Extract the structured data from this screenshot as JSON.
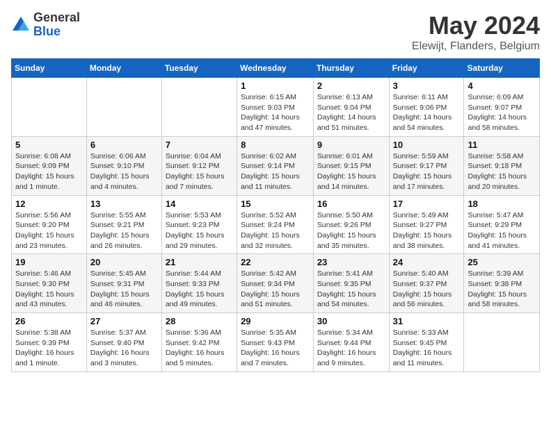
{
  "logo": {
    "general": "General",
    "blue": "Blue"
  },
  "header": {
    "month_year": "May 2024",
    "location": "Elewijt, Flanders, Belgium"
  },
  "weekdays": [
    "Sunday",
    "Monday",
    "Tuesday",
    "Wednesday",
    "Thursday",
    "Friday",
    "Saturday"
  ],
  "weeks": [
    [
      {
        "day": "",
        "info": ""
      },
      {
        "day": "",
        "info": ""
      },
      {
        "day": "",
        "info": ""
      },
      {
        "day": "1",
        "info": "Sunrise: 6:15 AM\nSunset: 9:03 PM\nDaylight: 14 hours and 47 minutes."
      },
      {
        "day": "2",
        "info": "Sunrise: 6:13 AM\nSunset: 9:04 PM\nDaylight: 14 hours and 51 minutes."
      },
      {
        "day": "3",
        "info": "Sunrise: 6:11 AM\nSunset: 9:06 PM\nDaylight: 14 hours and 54 minutes."
      },
      {
        "day": "4",
        "info": "Sunrise: 6:09 AM\nSunset: 9:07 PM\nDaylight: 14 hours and 58 minutes."
      }
    ],
    [
      {
        "day": "5",
        "info": "Sunrise: 6:08 AM\nSunset: 9:09 PM\nDaylight: 15 hours and 1 minute."
      },
      {
        "day": "6",
        "info": "Sunrise: 6:06 AM\nSunset: 9:10 PM\nDaylight: 15 hours and 4 minutes."
      },
      {
        "day": "7",
        "info": "Sunrise: 6:04 AM\nSunset: 9:12 PM\nDaylight: 15 hours and 7 minutes."
      },
      {
        "day": "8",
        "info": "Sunrise: 6:02 AM\nSunset: 9:14 PM\nDaylight: 15 hours and 11 minutes."
      },
      {
        "day": "9",
        "info": "Sunrise: 6:01 AM\nSunset: 9:15 PM\nDaylight: 15 hours and 14 minutes."
      },
      {
        "day": "10",
        "info": "Sunrise: 5:59 AM\nSunset: 9:17 PM\nDaylight: 15 hours and 17 minutes."
      },
      {
        "day": "11",
        "info": "Sunrise: 5:58 AM\nSunset: 9:18 PM\nDaylight: 15 hours and 20 minutes."
      }
    ],
    [
      {
        "day": "12",
        "info": "Sunrise: 5:56 AM\nSunset: 9:20 PM\nDaylight: 15 hours and 23 minutes."
      },
      {
        "day": "13",
        "info": "Sunrise: 5:55 AM\nSunset: 9:21 PM\nDaylight: 15 hours and 26 minutes."
      },
      {
        "day": "14",
        "info": "Sunrise: 5:53 AM\nSunset: 9:23 PM\nDaylight: 15 hours and 29 minutes."
      },
      {
        "day": "15",
        "info": "Sunrise: 5:52 AM\nSunset: 9:24 PM\nDaylight: 15 hours and 32 minutes."
      },
      {
        "day": "16",
        "info": "Sunrise: 5:50 AM\nSunset: 9:26 PM\nDaylight: 15 hours and 35 minutes."
      },
      {
        "day": "17",
        "info": "Sunrise: 5:49 AM\nSunset: 9:27 PM\nDaylight: 15 hours and 38 minutes."
      },
      {
        "day": "18",
        "info": "Sunrise: 5:47 AM\nSunset: 9:29 PM\nDaylight: 15 hours and 41 minutes."
      }
    ],
    [
      {
        "day": "19",
        "info": "Sunrise: 5:46 AM\nSunset: 9:30 PM\nDaylight: 15 hours and 43 minutes."
      },
      {
        "day": "20",
        "info": "Sunrise: 5:45 AM\nSunset: 9:31 PM\nDaylight: 15 hours and 46 minutes."
      },
      {
        "day": "21",
        "info": "Sunrise: 5:44 AM\nSunset: 9:33 PM\nDaylight: 15 hours and 49 minutes."
      },
      {
        "day": "22",
        "info": "Sunrise: 5:42 AM\nSunset: 9:34 PM\nDaylight: 15 hours and 51 minutes."
      },
      {
        "day": "23",
        "info": "Sunrise: 5:41 AM\nSunset: 9:35 PM\nDaylight: 15 hours and 54 minutes."
      },
      {
        "day": "24",
        "info": "Sunrise: 5:40 AM\nSunset: 9:37 PM\nDaylight: 15 hours and 56 minutes."
      },
      {
        "day": "25",
        "info": "Sunrise: 5:39 AM\nSunset: 9:38 PM\nDaylight: 15 hours and 58 minutes."
      }
    ],
    [
      {
        "day": "26",
        "info": "Sunrise: 5:38 AM\nSunset: 9:39 PM\nDaylight: 16 hours and 1 minute."
      },
      {
        "day": "27",
        "info": "Sunrise: 5:37 AM\nSunset: 9:40 PM\nDaylight: 16 hours and 3 minutes."
      },
      {
        "day": "28",
        "info": "Sunrise: 5:36 AM\nSunset: 9:42 PM\nDaylight: 16 hours and 5 minutes."
      },
      {
        "day": "29",
        "info": "Sunrise: 5:35 AM\nSunset: 9:43 PM\nDaylight: 16 hours and 7 minutes."
      },
      {
        "day": "30",
        "info": "Sunrise: 5:34 AM\nSunset: 9:44 PM\nDaylight: 16 hours and 9 minutes."
      },
      {
        "day": "31",
        "info": "Sunrise: 5:33 AM\nSunset: 9:45 PM\nDaylight: 16 hours and 11 minutes."
      },
      {
        "day": "",
        "info": ""
      }
    ]
  ]
}
